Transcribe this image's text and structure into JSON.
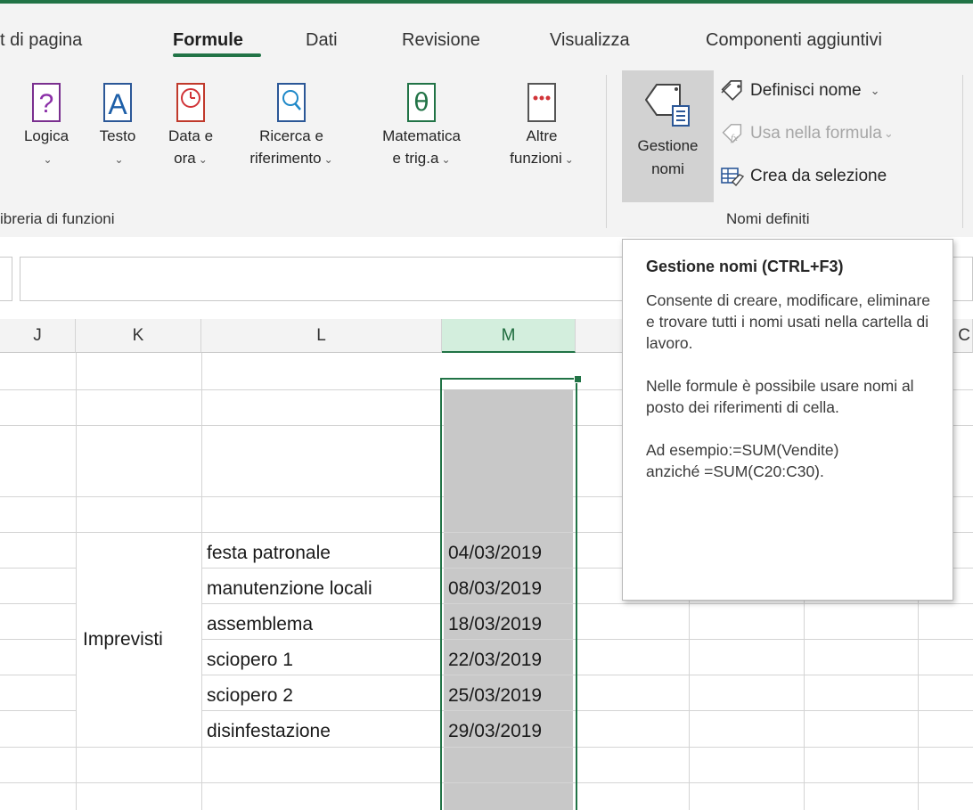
{
  "tabs": [
    {
      "label": "t di pagina",
      "active": false
    },
    {
      "label": "Formule",
      "active": true
    },
    {
      "label": "Dati",
      "active": false
    },
    {
      "label": "Revisione",
      "active": false
    },
    {
      "label": "Visualizza",
      "active": false
    },
    {
      "label": "Componenti aggiuntivi",
      "active": false
    }
  ],
  "functions_group": {
    "label": "ibreria di funzioni",
    "buttons": [
      {
        "name": "logica",
        "line1": "Logica",
        "line2": "",
        "icon": "question-mark-icon"
      },
      {
        "name": "testo",
        "line1": "Testo",
        "line2": "",
        "icon": "letter-a-icon"
      },
      {
        "name": "data-ora",
        "line1": "Data e",
        "line2": "ora",
        "icon": "clock-icon"
      },
      {
        "name": "ricerca",
        "line1": "Ricerca e",
        "line2": "riferimento",
        "icon": "magnifier-icon"
      },
      {
        "name": "matematica",
        "line1": "Matematica",
        "line2": "e trig.a",
        "icon": "theta-icon"
      },
      {
        "name": "altre",
        "line1": "Altre",
        "line2": "funzioni",
        "icon": "more-dots-icon"
      }
    ]
  },
  "names_group": {
    "label": "Nomi definiti",
    "gestione_line1": "Gestione",
    "gestione_line2": "nomi",
    "definisci": "Definisci nome",
    "usa": "Usa nella formula",
    "crea": "Crea da selezione"
  },
  "tooltip": {
    "title": "Gestione nomi (CTRL+F3)",
    "p1": "Consente di creare, modificare, eliminare e trovare tutti i nomi usati nella cartella di lavoro.",
    "p2": "Nelle formule è possibile usare nomi al posto dei riferimenti di cella.",
    "p3_line1": "Ad esempio:=SUM(Vendite)",
    "p3_line2": "anziché =SUM(C20:C30)."
  },
  "columns": [
    "J",
    "K",
    "L",
    "M",
    "C"
  ],
  "sheet": {
    "k_label": "Imprevisti",
    "rows": [
      {
        "event": "festa patronale",
        "date": "04/03/2019"
      },
      {
        "event": "manutenzione locali",
        "date": "08/03/2019"
      },
      {
        "event": "assemblema",
        "date": "18/03/2019"
      },
      {
        "event": "sciopero 1",
        "date": "22/03/2019"
      },
      {
        "event": "sciopero 2",
        "date": "25/03/2019"
      },
      {
        "event": "disinfestazione",
        "date": "29/03/2019"
      }
    ]
  },
  "colors": {
    "accent": "#217346",
    "selected_header": "#d3eedd",
    "fill_gray": "#c8c8c8"
  }
}
